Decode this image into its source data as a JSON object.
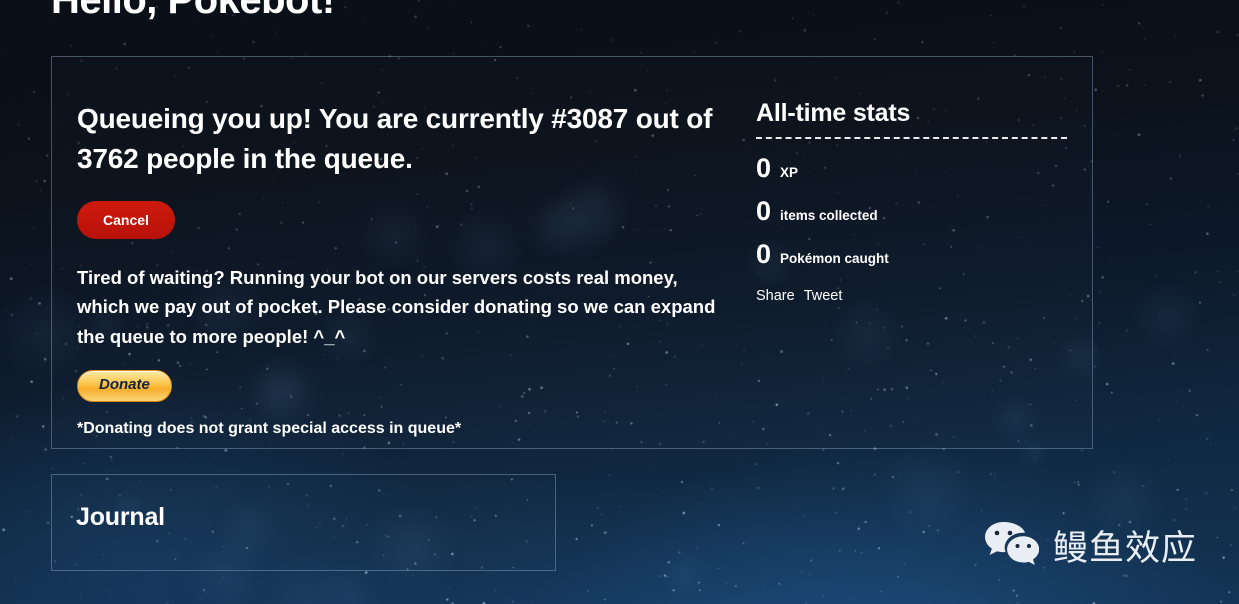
{
  "page": {
    "title": "Hello, Pokebot!"
  },
  "queue": {
    "headline": "Queueing you up! You are currently #3087 out of 3762 people in the queue.",
    "position": 3087,
    "total": 3762,
    "cancel_label": "Cancel",
    "body_copy": "Tired of waiting? Running your bot on our servers costs real money, which we pay out of pocket. Please consider donating so we can expand the queue to more people! ^_^",
    "donate_label": "Donate",
    "disclaimer": "*Donating does not grant special access in queue*"
  },
  "stats": {
    "title": "All-time stats",
    "rows": [
      {
        "value": "0",
        "label": "XP"
      },
      {
        "value": "0",
        "label": "items collected"
      },
      {
        "value": "0",
        "label": "Pokémon caught"
      }
    ],
    "share_label": "Share",
    "tweet_label": "Tweet"
  },
  "journal": {
    "title": "Journal"
  },
  "watermark": {
    "text": "鳗鱼效应",
    "icon": "wechat-icon"
  },
  "colors": {
    "cancel_red": "#c0140a",
    "donate_gold": "#f6ae2b",
    "text_white": "#ffffff",
    "bg_top": "#0a0f18",
    "bg_bottom": "#133455"
  }
}
